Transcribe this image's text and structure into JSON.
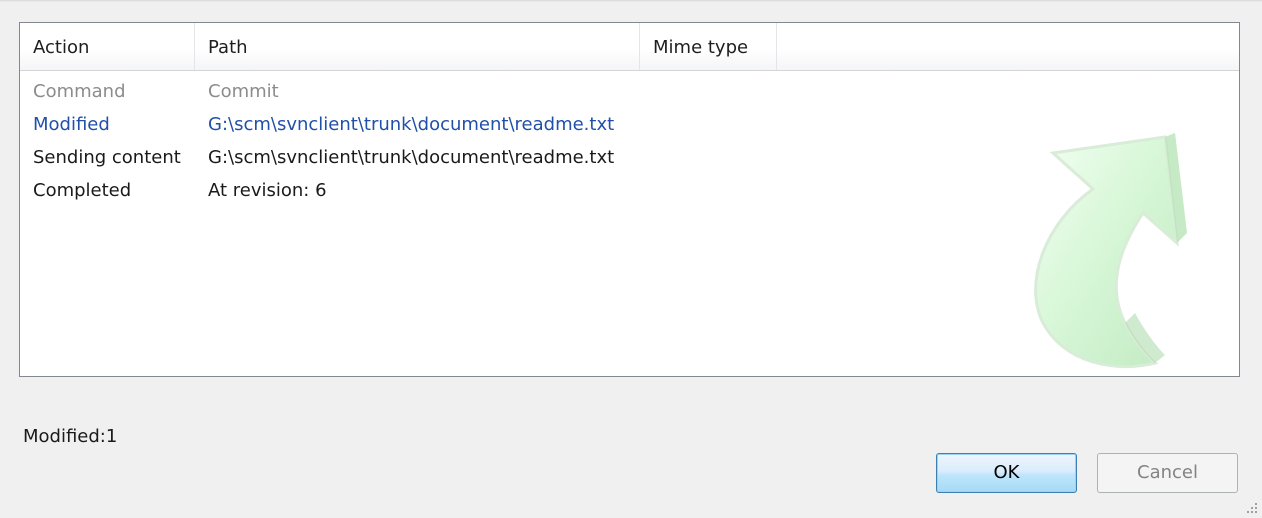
{
  "columns": {
    "action": "Action",
    "path": "Path",
    "mime_type": "Mime type"
  },
  "rows": [
    {
      "action": "Command",
      "path": "Commit",
      "style": "gray"
    },
    {
      "action": "Modified",
      "path": "G:\\scm\\svnclient\\trunk\\document\\readme.txt",
      "style": "blue"
    },
    {
      "action": "Sending content",
      "path": "G:\\scm\\svnclient\\trunk\\document\\readme.txt",
      "style": "black"
    },
    {
      "action": "Completed",
      "path": "At revision: 6",
      "style": "black"
    }
  ],
  "status": {
    "text": "Modified:1"
  },
  "buttons": {
    "ok": "OK",
    "cancel": "Cancel"
  },
  "icons": {
    "watermark": "green-curved-arrow-icon",
    "grip": "resize-grip-icon"
  },
  "colors": {
    "gray_row": "#8c8c8c",
    "modified_row": "#2050a8",
    "normal_row": "#1a1a1a",
    "ok_border": "#3c7fb1",
    "arrow_fill": "#c8f0c8"
  },
  "cancel_enabled": false
}
